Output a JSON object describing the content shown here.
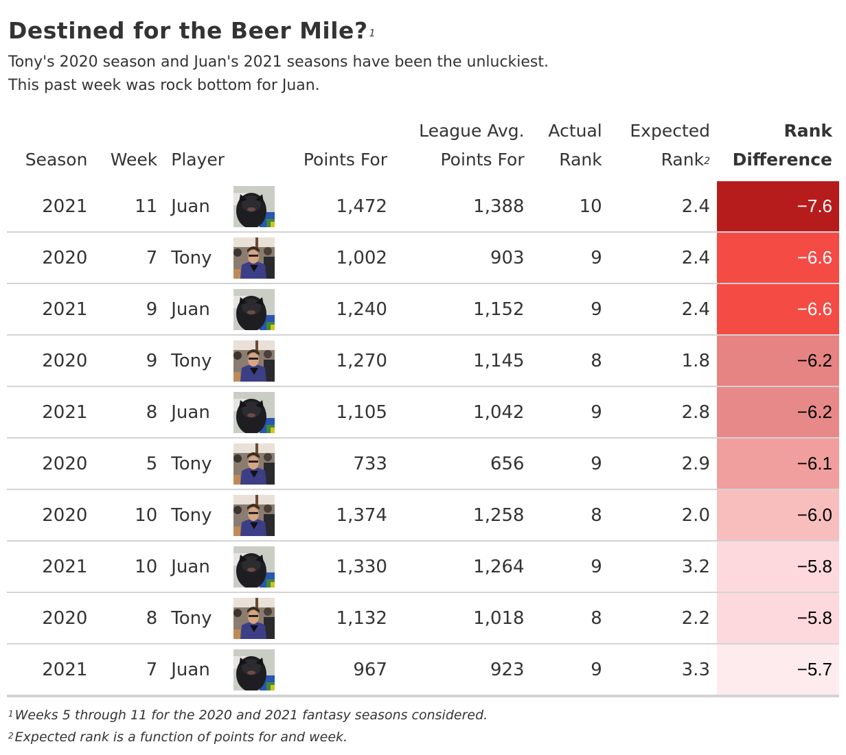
{
  "header": {
    "title": "Destined for the Beer Mile?",
    "title_footnote_mark": "1",
    "subtitle_line1": "Tony's 2020 season and Juan's 2021 seasons have been the unluckiest.",
    "subtitle_line2": "This past week was rock bottom for Juan."
  },
  "columns": {
    "season": "Season",
    "week": "Week",
    "player": "Player",
    "points_for": "Points For",
    "league_avg_line1": "League Avg.",
    "league_avg_line2": "Points For",
    "actual_rank_line1": "Actual",
    "actual_rank_line2": "Rank",
    "expected_rank_line1": "Expected",
    "expected_rank_line2": "Rank",
    "expected_rank_footnote_mark": "2",
    "rank_diff_line1": "Rank",
    "rank_diff_line2": "Difference"
  },
  "avatars": {
    "Juan": "dog-photo",
    "Tony": "person-photo"
  },
  "chart_data": {
    "type": "table",
    "title": "Destined for the Beer Mile?",
    "columns": [
      "Season",
      "Week",
      "Player",
      "Points For",
      "League Avg. Points For",
      "Actual Rank",
      "Expected Rank",
      "Rank Difference"
    ],
    "rows": [
      {
        "season": "2021",
        "week": "11",
        "player": "Juan",
        "points_for": "1,472",
        "league_avg": "1,388",
        "actual_rank": "10",
        "expected_rank": "2.4",
        "rank_diff": "−7.6",
        "diff_color": "#b71c1c",
        "text_color": "#ffffff"
      },
      {
        "season": "2020",
        "week": "7",
        "player": "Tony",
        "points_for": "1,002",
        "league_avg": "903",
        "actual_rank": "9",
        "expected_rank": "2.4",
        "rank_diff": "−6.6",
        "diff_color": "#f44b45",
        "text_color": "#ffffff"
      },
      {
        "season": "2021",
        "week": "9",
        "player": "Juan",
        "points_for": "1,240",
        "league_avg": "1,152",
        "actual_rank": "9",
        "expected_rank": "2.4",
        "rank_diff": "−6.6",
        "diff_color": "#f44b45",
        "text_color": "#ffffff"
      },
      {
        "season": "2020",
        "week": "9",
        "player": "Tony",
        "points_for": "1,270",
        "league_avg": "1,145",
        "actual_rank": "8",
        "expected_rank": "1.8",
        "rank_diff": "−6.2",
        "diff_color": "#e68383",
        "text_color": "#000000"
      },
      {
        "season": "2021",
        "week": "8",
        "player": "Juan",
        "points_for": "1,105",
        "league_avg": "1,042",
        "actual_rank": "9",
        "expected_rank": "2.8",
        "rank_diff": "−6.2",
        "diff_color": "#e88989",
        "text_color": "#000000"
      },
      {
        "season": "2020",
        "week": "5",
        "player": "Tony",
        "points_for": "733",
        "league_avg": "656",
        "actual_rank": "9",
        "expected_rank": "2.9",
        "rank_diff": "−6.1",
        "diff_color": "#f09e9e",
        "text_color": "#000000"
      },
      {
        "season": "2020",
        "week": "10",
        "player": "Tony",
        "points_for": "1,374",
        "league_avg": "1,258",
        "actual_rank": "8",
        "expected_rank": "2.0",
        "rank_diff": "−6.0",
        "diff_color": "#f8bebe",
        "text_color": "#000000"
      },
      {
        "season": "2021",
        "week": "10",
        "player": "Juan",
        "points_for": "1,330",
        "league_avg": "1,264",
        "actual_rank": "9",
        "expected_rank": "3.2",
        "rank_diff": "−5.8",
        "diff_color": "#fdd9dd",
        "text_color": "#000000"
      },
      {
        "season": "2020",
        "week": "8",
        "player": "Tony",
        "points_for": "1,132",
        "league_avg": "1,018",
        "actual_rank": "8",
        "expected_rank": "2.2",
        "rank_diff": "−5.8",
        "diff_color": "#fdd9dd",
        "text_color": "#000000"
      },
      {
        "season": "2021",
        "week": "7",
        "player": "Juan",
        "points_for": "967",
        "league_avg": "923",
        "actual_rank": "9",
        "expected_rank": "3.3",
        "rank_diff": "−5.7",
        "diff_color": "#feebed",
        "text_color": "#000000"
      }
    ]
  },
  "footnotes": [
    {
      "mark": "1",
      "text": "Weeks 5 through 11 for the 2020 and 2021 fantasy seasons considered."
    },
    {
      "mark": "2",
      "text": "Expected rank is a function of points for and week."
    }
  ]
}
